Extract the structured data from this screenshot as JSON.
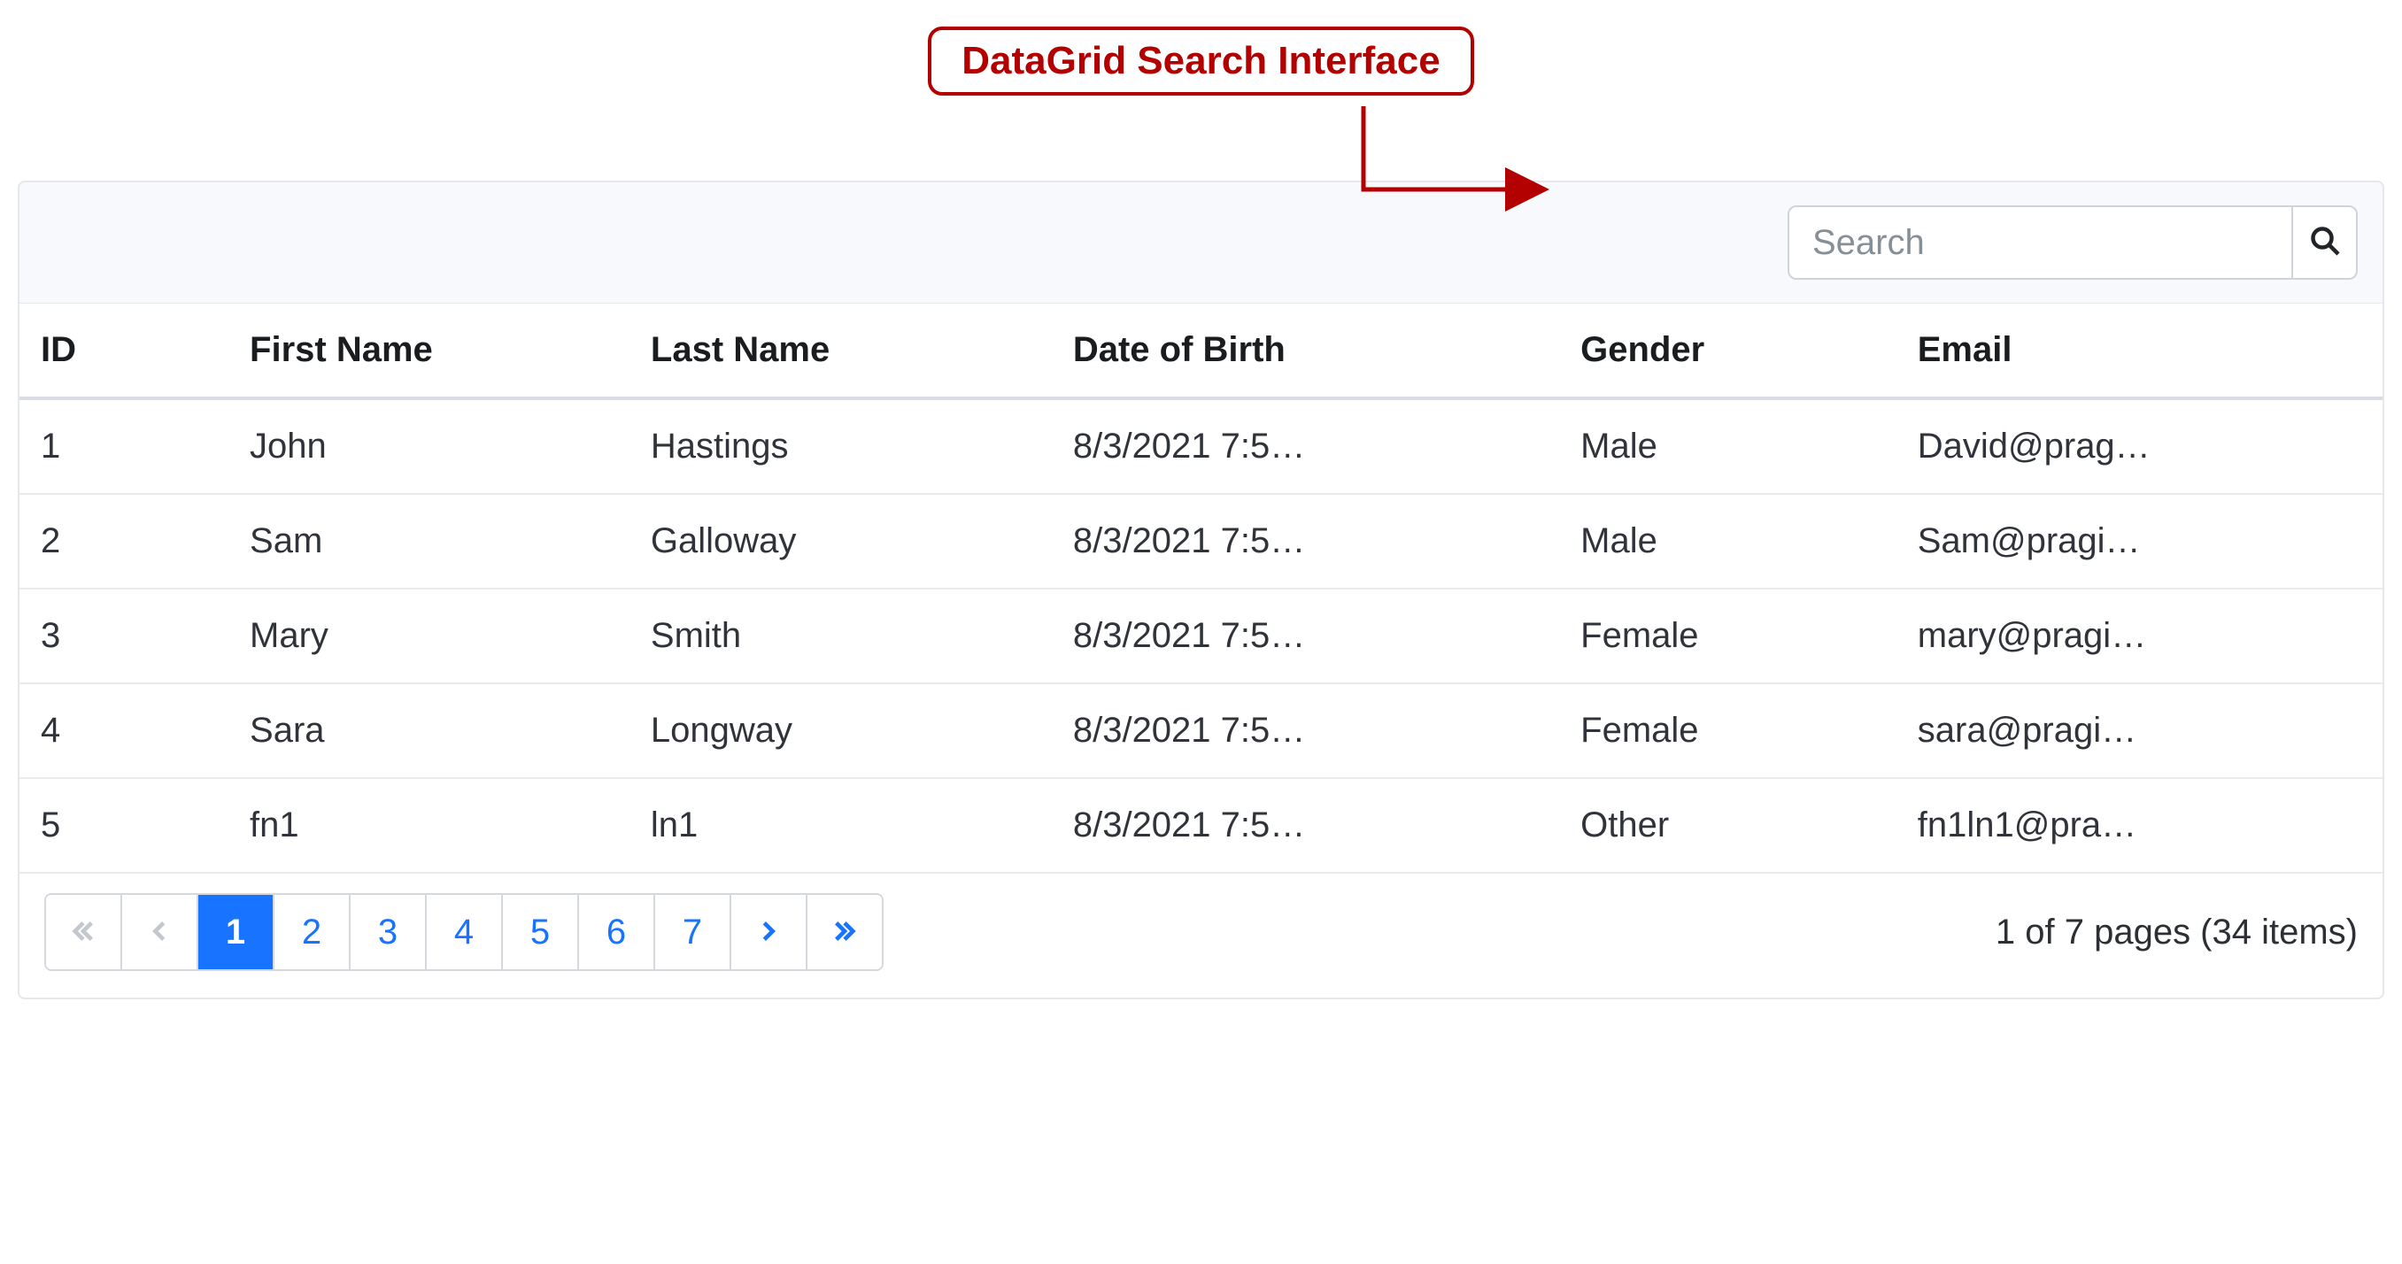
{
  "annotation": {
    "label": "DataGrid Search Interface"
  },
  "toolbar": {
    "search_placeholder": "Search",
    "search_value": ""
  },
  "columns": [
    {
      "key": "id",
      "label": "ID"
    },
    {
      "key": "first_name",
      "label": "First Name"
    },
    {
      "key": "last_name",
      "label": "Last Name"
    },
    {
      "key": "dob",
      "label": "Date of Birth"
    },
    {
      "key": "gender",
      "label": "Gender"
    },
    {
      "key": "email",
      "label": "Email"
    }
  ],
  "rows": [
    {
      "id": "1",
      "first_name": "John",
      "last_name": "Hastings",
      "dob": "8/3/2021 7:5…",
      "gender": "Male",
      "email": "David@prag…"
    },
    {
      "id": "2",
      "first_name": "Sam",
      "last_name": "Galloway",
      "dob": "8/3/2021 7:5…",
      "gender": "Male",
      "email": "Sam@pragi…"
    },
    {
      "id": "3",
      "first_name": "Mary",
      "last_name": "Smith",
      "dob": "8/3/2021 7:5…",
      "gender": "Female",
      "email": "mary@pragi…"
    },
    {
      "id": "4",
      "first_name": "Sara",
      "last_name": "Longway",
      "dob": "8/3/2021 7:5…",
      "gender": "Female",
      "email": "sara@pragi…"
    },
    {
      "id": "5",
      "first_name": "fn1",
      "last_name": "ln1",
      "dob": "8/3/2021 7:5…",
      "gender": "Other",
      "email": "fn1ln1@pra…"
    }
  ],
  "pager": {
    "pages": [
      "1",
      "2",
      "3",
      "4",
      "5",
      "6",
      "7"
    ],
    "current_page": "1",
    "total_pages": "7",
    "total_items": "34",
    "summary": "1 of 7 pages (34 items)"
  },
  "colors": {
    "accent": "#1874ff",
    "callout": "#b30000"
  }
}
